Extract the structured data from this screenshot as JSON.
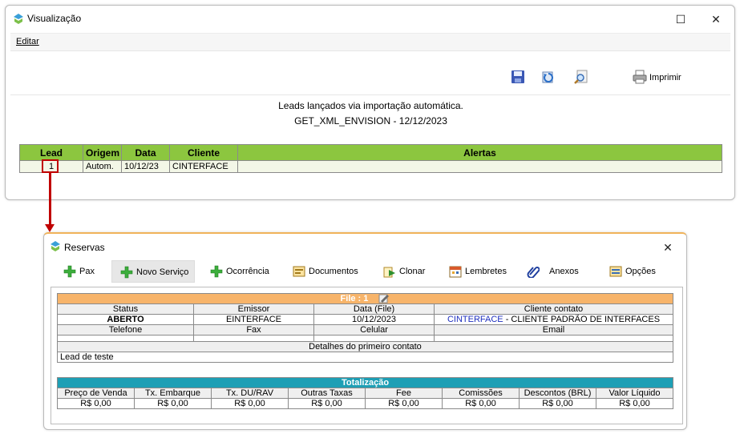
{
  "window1": {
    "title": "Visualização",
    "menu": [
      "Editar"
    ],
    "toolbar": {
      "icons": [
        "save-icon",
        "refresh-icon",
        "preview-icon",
        "printer-icon"
      ],
      "print_label": "Imprimir"
    },
    "heading_line1": "Leads lançados via importação automática.",
    "heading_line2": "GET_XML_ENVISION - 12/12/2023",
    "leads_table": {
      "headers": [
        "Lead",
        "Origem",
        "Data",
        "Cliente",
        "Alertas"
      ],
      "rows": [
        [
          "1",
          "Autom.",
          "10/12/23",
          "CINTERFACE",
          ""
        ]
      ]
    }
  },
  "window2": {
    "title": "Reservas",
    "toolbar": [
      {
        "label": "Pax",
        "icon": "plus-icon"
      },
      {
        "label": "Novo Serviço",
        "icon": "plus-icon"
      },
      {
        "label": "Ocorrência",
        "icon": "plus-icon"
      },
      {
        "label": "Documentos",
        "icon": "documents-icon"
      },
      {
        "label": "Clonar",
        "icon": "clone-icon"
      },
      {
        "label": "Lembretes",
        "icon": "reminders-icon"
      },
      {
        "label": "Anexos",
        "icon": "paperclip-icon"
      },
      {
        "label": "Opções",
        "icon": "options-icon"
      }
    ],
    "file": {
      "title": "File : 1",
      "headers1": [
        "Status",
        "Emissor",
        "Data (File)",
        "Cliente contato"
      ],
      "values1": {
        "status": "ABERTO",
        "emissor": "EINTERFACE",
        "data": "10/12/2023",
        "cliente_link": "CINTERFACE",
        "cliente_rest": " - CLIENTE PADRÃO DE INTERFACES"
      },
      "headers2": [
        "Telefone",
        "Fax",
        "Celular",
        "Email"
      ],
      "details_header": "Detalhes do primeiro contato",
      "details_value": "Lead de teste"
    },
    "totals": {
      "title": "Totalização",
      "headers": [
        "Preço de Venda",
        "Tx. Embarque",
        "Tx. DU/RAV",
        "Outras Taxas",
        "Fee",
        "Comissões",
        "Descontos (BRL)",
        "Valor Líquido"
      ],
      "values": [
        "R$ 0,00",
        "R$ 0,00",
        "R$ 0,00",
        "R$ 0,00",
        "R$ 0,00",
        "R$ 0,00",
        "R$ 0,00",
        "R$ 0,00"
      ]
    }
  },
  "colors": {
    "leads_header": "#8cc63f",
    "file_header": "#f7b46a",
    "totals_header": "#1e9fb5",
    "highlight": "#c00000"
  }
}
